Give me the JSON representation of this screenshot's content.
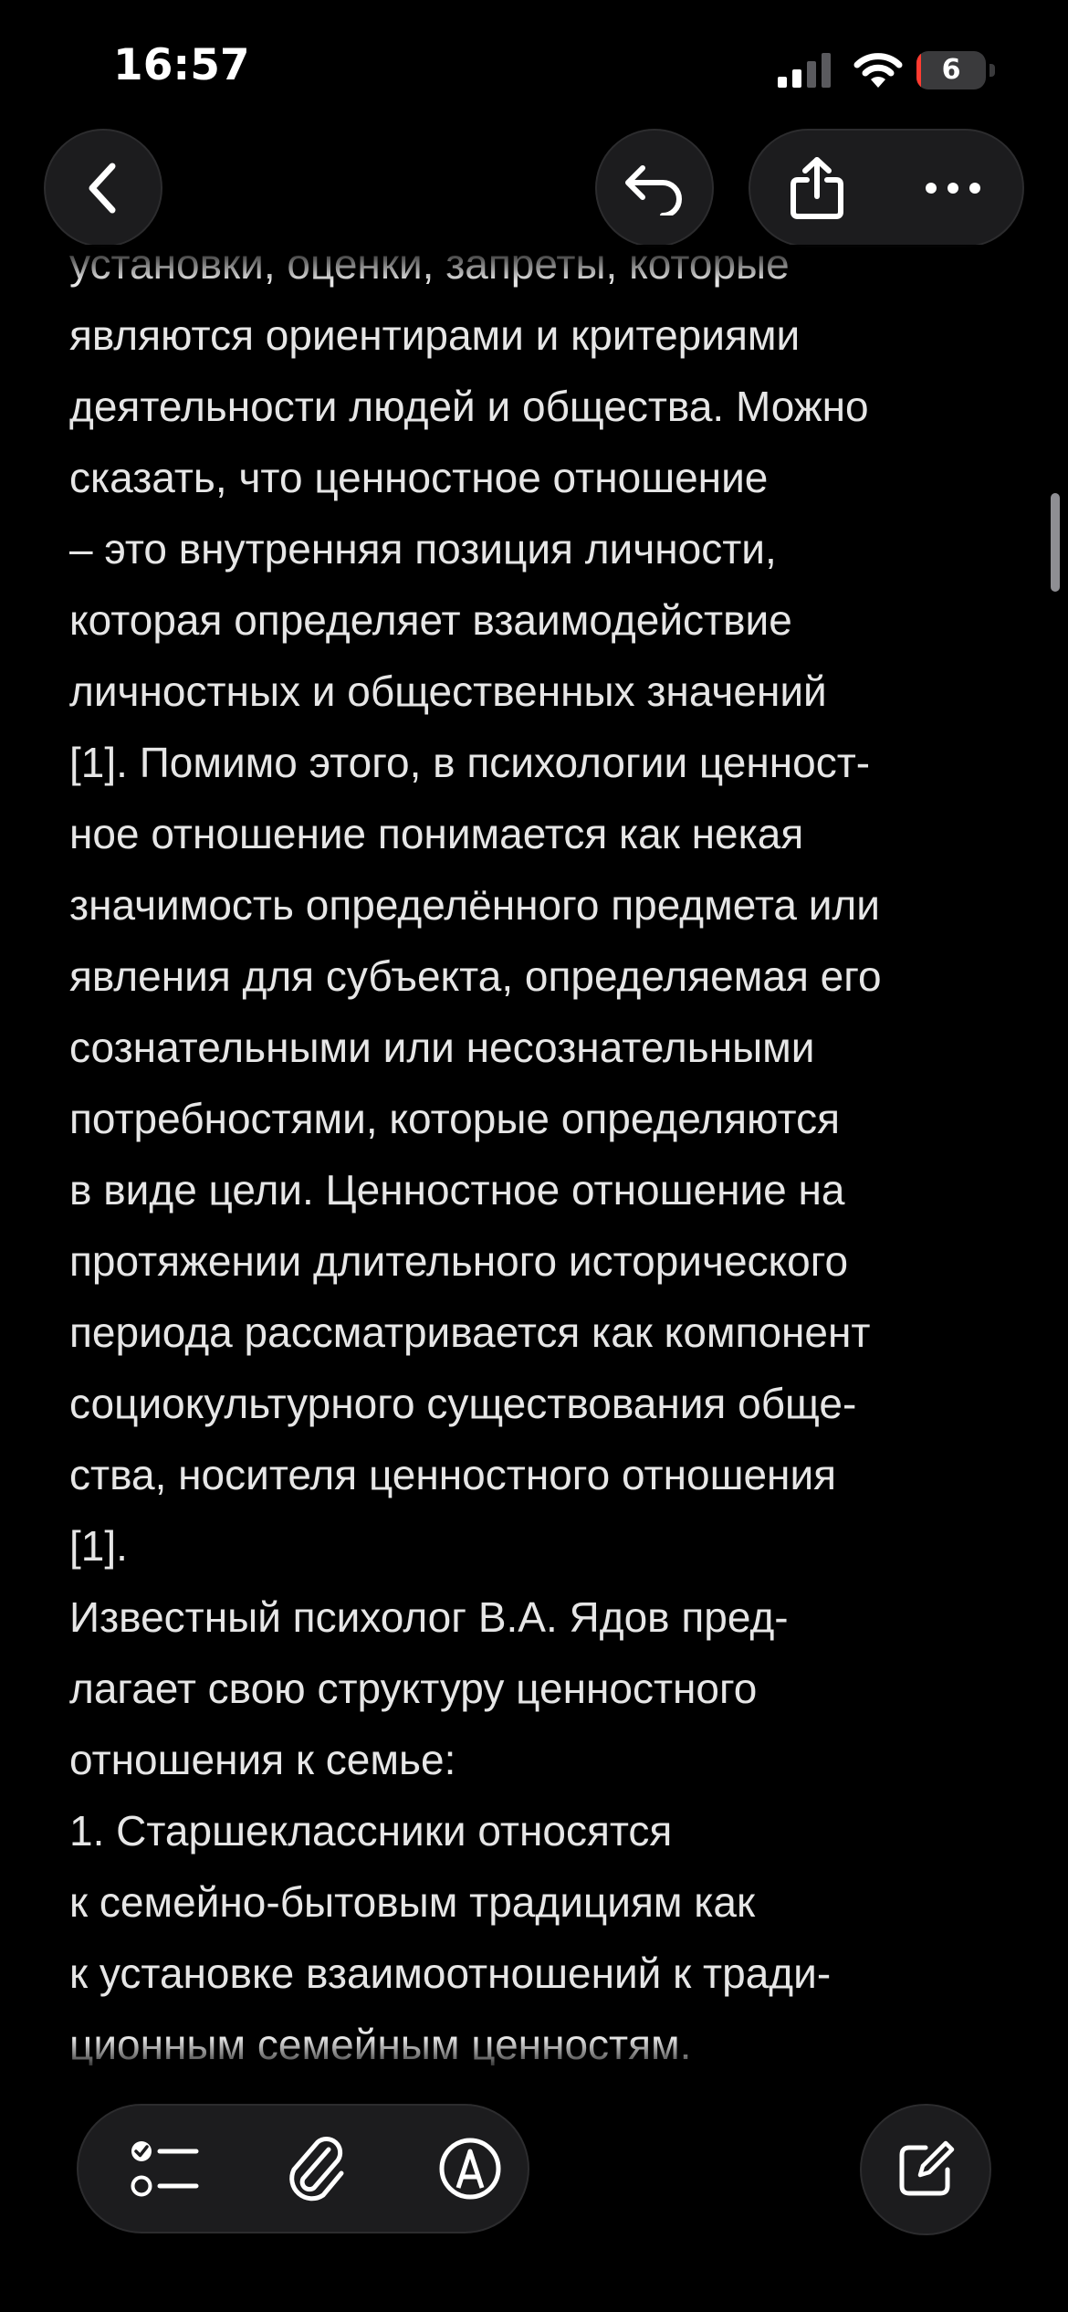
{
  "status_bar": {
    "time": "16:57",
    "battery_level": "6",
    "battery_fraction": 0.06,
    "battery_color": "#ff3b30",
    "icons": [
      "cellular-signal-icon",
      "wifi-icon",
      "battery-icon"
    ]
  },
  "top_bar": {
    "back_icon": "chevron-left-icon",
    "undo_icon": "undo-arrow-icon",
    "share_icon": "share-icon",
    "more_icon": "ellipsis-icon"
  },
  "note": {
    "lines": [
      "установки, оценки, запреты, которые",
      "являются ориентирами и критериями",
      "деятельности людей и общества. Можно",
      "сказать, что ценностное отношение",
      "– это внутренняя позиция личности,",
      "которая определяет взаимодействие",
      "личностных и общественных значений",
      "[1]. Помимо этого, в психологии ценност-",
      "ное отношение понимается как некая",
      "значимость определённого предмета или",
      "явления для субъекта, определяемая его",
      "сознательными или несознательными",
      "потребностями, которые определяются",
      "в виде цели. Ценностное отношение на",
      "протяжении длительного исторического",
      "периода рассматривается как компонент",
      "социокультурного существования обще-",
      "ства, носителя ценностного отношения",
      "[1].",
      "Известный психолог В.А. Ядов пред-",
      "лагает свою структуру ценностного",
      "отношения к семье:",
      "1. Старшеклассники относятся",
      "к семейно-бытовым традициям как",
      "к установке взаимоотношений к тради-",
      "ционным семейным ценностям."
    ]
  },
  "bottom_toolbar": {
    "checklist_icon": "checklist-icon",
    "attachment_icon": "paperclip-icon",
    "markup_icon": "markup-pen-icon",
    "compose_icon": "compose-icon"
  },
  "colors": {
    "background": "#000000",
    "button_fill": "#1c1c1e",
    "text": "#e6e6e6"
  }
}
